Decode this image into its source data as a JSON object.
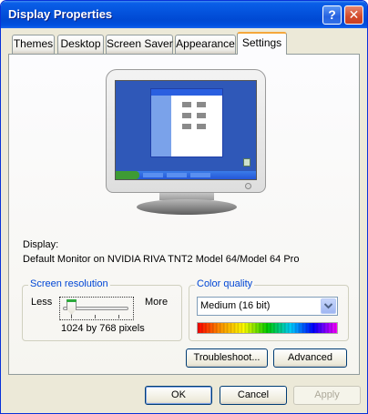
{
  "window": {
    "title": "Display Properties",
    "help_label": "?",
    "close_label": "✕"
  },
  "tabs": [
    {
      "label": "Themes"
    },
    {
      "label": "Desktop"
    },
    {
      "label": "Screen Saver"
    },
    {
      "label": "Appearance"
    },
    {
      "label": "Settings",
      "active": true
    }
  ],
  "display": {
    "label": "Display:",
    "value": "Default Monitor on NVIDIA RIVA TNT2 Model 64/Model 64 Pro"
  },
  "resolution": {
    "title": "Screen resolution",
    "less_label": "Less",
    "more_label": "More",
    "value_text": "1024 by 768 pixels"
  },
  "color_quality": {
    "title": "Color quality",
    "selected": "Medium (16 bit)"
  },
  "buttons": {
    "troubleshoot": "Troubleshoot...",
    "advanced": "Advanced",
    "ok": "OK",
    "cancel": "Cancel",
    "apply": "Apply"
  },
  "colors": {
    "titlebar": "#0453dd",
    "dialog_bg": "#ece9d8",
    "group_title": "#0046d5",
    "active_tab_accent": "#f5a73b"
  },
  "icons": [
    "help-icon",
    "close-icon",
    "monitor-icon",
    "chevron-down-icon"
  ]
}
